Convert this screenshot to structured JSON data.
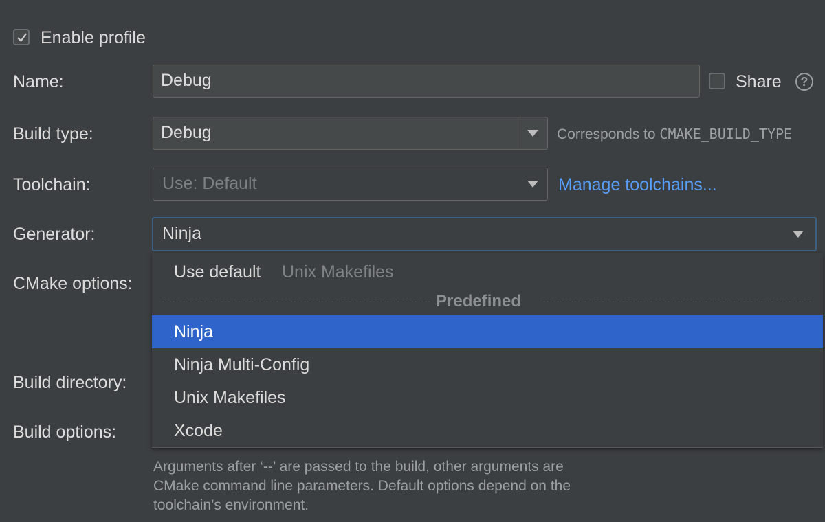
{
  "enable_profile": {
    "label": "Enable profile",
    "checked": true
  },
  "name": {
    "label": "Name:",
    "value": "Debug"
  },
  "share": {
    "label": "Share",
    "checked": false,
    "help_icon": "question-circle-icon"
  },
  "build_type": {
    "label": "Build type:",
    "value": "Debug",
    "hint_prefix": "Corresponds to ",
    "hint_code": "CMAKE_BUILD_TYPE"
  },
  "toolchain": {
    "label": "Toolchain:",
    "value": "Use: Default",
    "link": "Manage toolchains..."
  },
  "generator": {
    "label": "Generator:",
    "value": "Ninja",
    "popup": {
      "default_item": {
        "label": "Use default",
        "detail": "Unix Makefiles"
      },
      "group_title": "Predefined",
      "items": [
        "Ninja",
        "Ninja Multi-Config",
        "Unix Makefiles",
        "Xcode"
      ],
      "selected_index": 0
    }
  },
  "cmake_options": {
    "label": "CMake options:"
  },
  "build_directory": {
    "label": "Build directory:"
  },
  "build_options": {
    "label": "Build options:",
    "help_lines": [
      "Arguments after ‘--’ are passed to the build, other arguments are",
      "CMake command line parameters. Default options depend on the",
      "toolchain’s environment."
    ]
  },
  "colors": {
    "accent": "#2f65ca",
    "link": "#589df6",
    "background": "#3c3f41",
    "focus_border": "#3d6185"
  }
}
